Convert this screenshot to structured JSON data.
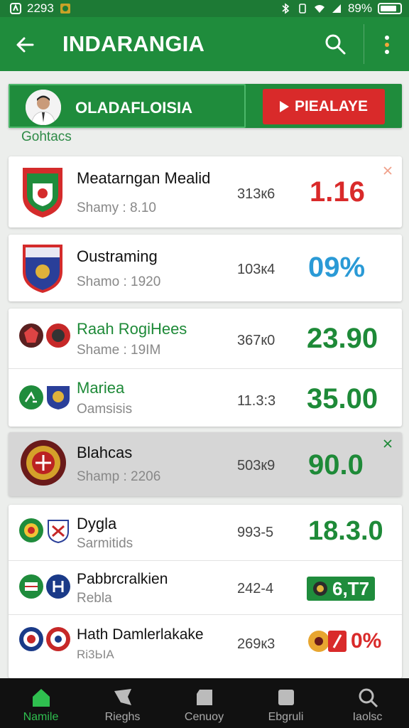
{
  "status_bar": {
    "time": "2293",
    "battery": "89%"
  },
  "app_bar": {
    "title": "INDARANGIA"
  },
  "banner": {
    "name": "OLADAFLOISIA",
    "play_label": "PIEALAYE"
  },
  "section_label": "Gohtacs",
  "colors": {
    "primary": "#1f8c3c",
    "red": "#d92a2a",
    "blue": "#2a9ad6",
    "green": "#1e8a38"
  },
  "rows": [
    {
      "name": "Meatarngan Mealid",
      "sub": "Shamy : 8.10",
      "mid": "313к6",
      "value": "1.16"
    },
    {
      "name": "Oustraming",
      "sub": "Shamo : 1920",
      "mid": "103к4",
      "value": "09%"
    },
    {
      "name": "Raah RogiHees",
      "sub": "Shame : 19IM",
      "mid": "367к0",
      "value": "23.90"
    },
    {
      "name": "Mariea",
      "sub": "Oamsisis",
      "mid": "11.3:3",
      "value": "35.00"
    },
    {
      "name": "Blahcas",
      "sub": "Shamp : 2206",
      "mid": "503к9",
      "value": "90.0"
    },
    {
      "name": "Dygla",
      "sub": "Sarmitids",
      "mid": "993-5",
      "value": "18.3.0"
    },
    {
      "name": "Pabbrcralkien",
      "sub": "Rebla",
      "mid": "242-4",
      "value": "6,T7"
    },
    {
      "name": "Hath Damlerlakake",
      "sub": "Ri3ЬIA",
      "mid": "269к3",
      "value": "0%"
    }
  ],
  "nav": [
    {
      "label": "Namile"
    },
    {
      "label": "Rieghs"
    },
    {
      "label": "Cenuoy"
    },
    {
      "label": "Ebgruli"
    },
    {
      "label": "Iaolsc"
    }
  ]
}
